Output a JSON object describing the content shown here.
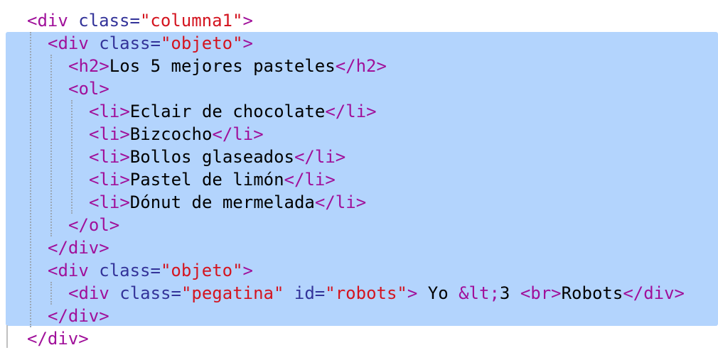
{
  "editor": {
    "lines": [
      {
        "indent": 1,
        "tokens": [
          {
            "t": "tag",
            "v": "<div"
          },
          {
            "t": "txt",
            "v": " "
          },
          {
            "t": "attr",
            "v": "class="
          },
          {
            "t": "val",
            "v": "\"columna1\""
          },
          {
            "t": "tag",
            "v": ">"
          }
        ]
      },
      {
        "indent": 2,
        "tokens": [
          {
            "t": "tag",
            "v": "<div"
          },
          {
            "t": "txt",
            "v": " "
          },
          {
            "t": "attr",
            "v": "class="
          },
          {
            "t": "val",
            "v": "\"objeto\""
          },
          {
            "t": "tag",
            "v": ">"
          }
        ]
      },
      {
        "indent": 3,
        "tokens": [
          {
            "t": "tag",
            "v": "<h2>"
          },
          {
            "t": "txt",
            "v": "Los 5 mejores pasteles"
          },
          {
            "t": "tag",
            "v": "</h2>"
          }
        ]
      },
      {
        "indent": 3,
        "tokens": [
          {
            "t": "tag",
            "v": "<ol>"
          }
        ]
      },
      {
        "indent": 4,
        "tokens": [
          {
            "t": "tag",
            "v": "<li>"
          },
          {
            "t": "txt",
            "v": "Eclair de chocolate"
          },
          {
            "t": "tag",
            "v": "</li>"
          }
        ]
      },
      {
        "indent": 4,
        "tokens": [
          {
            "t": "tag",
            "v": "<li>"
          },
          {
            "t": "txt",
            "v": "Bizcocho"
          },
          {
            "t": "tag",
            "v": "</li>"
          }
        ]
      },
      {
        "indent": 4,
        "tokens": [
          {
            "t": "tag",
            "v": "<li>"
          },
          {
            "t": "txt",
            "v": "Bollos glaseados"
          },
          {
            "t": "tag",
            "v": "</li>"
          }
        ]
      },
      {
        "indent": 4,
        "tokens": [
          {
            "t": "tag",
            "v": "<li>"
          },
          {
            "t": "txt",
            "v": "Pastel de limón"
          },
          {
            "t": "tag",
            "v": "</li>"
          }
        ]
      },
      {
        "indent": 4,
        "tokens": [
          {
            "t": "tag",
            "v": "<li>"
          },
          {
            "t": "txt",
            "v": "Dónut de mermelada"
          },
          {
            "t": "tag",
            "v": "</li>"
          }
        ]
      },
      {
        "indent": 3,
        "tokens": [
          {
            "t": "tag",
            "v": "</ol>"
          }
        ]
      },
      {
        "indent": 2,
        "tokens": [
          {
            "t": "tag",
            "v": "</div>"
          }
        ]
      },
      {
        "indent": 2,
        "tokens": [
          {
            "t": "tag",
            "v": "<div"
          },
          {
            "t": "txt",
            "v": " "
          },
          {
            "t": "attr",
            "v": "class="
          },
          {
            "t": "val",
            "v": "\"objeto\""
          },
          {
            "t": "tag",
            "v": ">"
          }
        ]
      },
      {
        "indent": 3,
        "tokens": [
          {
            "t": "tag",
            "v": "<div"
          },
          {
            "t": "txt",
            "v": " "
          },
          {
            "t": "attr",
            "v": "class="
          },
          {
            "t": "val",
            "v": "\"pegatina\""
          },
          {
            "t": "txt",
            "v": " "
          },
          {
            "t": "attr",
            "v": "id="
          },
          {
            "t": "val",
            "v": "\"robots\""
          },
          {
            "t": "tag",
            "v": ">"
          },
          {
            "t": "txt",
            "v": " Yo "
          },
          {
            "t": "tag",
            "v": "&lt;"
          },
          {
            "t": "txt",
            "v": "3 "
          },
          {
            "t": "tag",
            "v": "<br>"
          },
          {
            "t": "txt",
            "v": "Robots"
          },
          {
            "t": "tag",
            "v": "</div>"
          }
        ]
      },
      {
        "indent": 2,
        "tokens": [
          {
            "t": "tag",
            "v": "</div>"
          }
        ]
      },
      {
        "indent": 1,
        "tokens": [
          {
            "t": "tag",
            "v": "</div>"
          }
        ]
      }
    ],
    "colors": {
      "tag": "#a0109a",
      "attribute": "#333399",
      "value": "#d4141f",
      "text": "#000000",
      "selection": "#b3d4fd"
    }
  }
}
